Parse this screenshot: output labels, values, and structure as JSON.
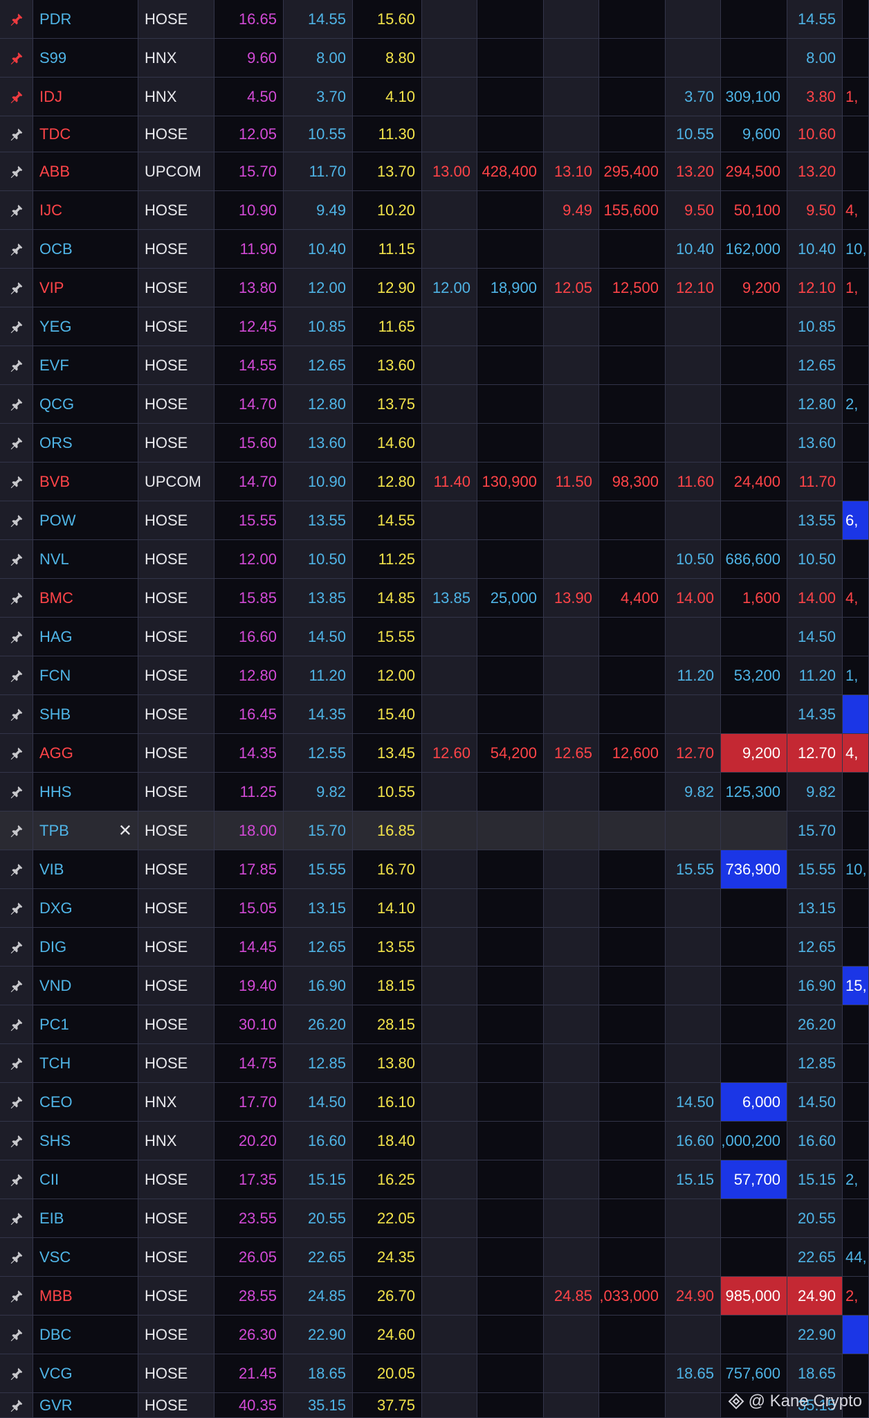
{
  "colors": {
    "ceiling": "#d24ad6",
    "floor": "#4fb4e6",
    "reference": "#f2e34a",
    "down": "#ff4448",
    "neutral": "#e8e8ec",
    "pin_active": "#ee3b40",
    "pin_default": "#c8c8cc",
    "bg_dark": "#0b0b12",
    "bg_alt": "#1d1d28"
  },
  "watermark": {
    "text": "@ Kane Crypto",
    "icon": "binance-diamond-icon"
  },
  "rows": [
    {
      "sym": "PDR",
      "sc": "floor",
      "ex": "HOSE",
      "ce": "16.65",
      "fl": "14.55",
      "rf": "15.60",
      "pin": "active",
      "b": [
        [
          "",
          ""
        ],
        [
          "",
          ""
        ],
        [
          "",
          ""
        ]
      ],
      "bc": [
        "",
        ""
      ],
      "m": [
        "14.55",
        "floor"
      ],
      "x": [
        "",
        ""
      ],
      "hl": ""
    },
    {
      "sym": "S99",
      "sc": "floor",
      "ex": "HNX",
      "ce": "9.60",
      "fl": "8.00",
      "rf": "8.80",
      "pin": "active",
      "b": [
        [
          "",
          ""
        ],
        [
          "",
          ""
        ],
        [
          "",
          ""
        ]
      ],
      "bc": [
        "",
        ""
      ],
      "m": [
        "8.00",
        "floor"
      ],
      "x": [
        "",
        ""
      ],
      "hl": ""
    },
    {
      "sym": "IDJ",
      "sc": "down",
      "ex": "HNX",
      "ce": "4.50",
      "fl": "3.70",
      "rf": "4.10",
      "pin": "active",
      "b": [
        [
          "",
          ""
        ],
        [
          "",
          ""
        ],
        [
          "3.70",
          "309,100"
        ]
      ],
      "bc": [
        "floor",
        "floor"
      ],
      "m": [
        "3.80",
        "down"
      ],
      "x": [
        "1,",
        "down"
      ],
      "hl": ""
    },
    {
      "sym": "TDC",
      "sc": "down",
      "ex": "HOSE",
      "ce": "12.05",
      "fl": "10.55",
      "rf": "11.30",
      "pin": "default",
      "b": [
        [
          "",
          ""
        ],
        [
          "",
          ""
        ],
        [
          "10.55",
          "9,600"
        ]
      ],
      "bc": [
        "floor",
        "floor"
      ],
      "m": [
        "10.60",
        "down"
      ],
      "x": [
        "",
        ""
      ],
      "hl": ""
    },
    {
      "sym": "ABB",
      "sc": "down",
      "ex": "UPCOM",
      "ce": "15.70",
      "fl": "11.70",
      "rf": "13.70",
      "pin": "default",
      "b": [
        [
          "13.00",
          "428,400"
        ],
        [
          "13.10",
          "295,400"
        ],
        [
          "13.20",
          "294,500"
        ]
      ],
      "bc": [
        "down",
        "down"
      ],
      "m": [
        "13.20",
        "down"
      ],
      "x": [
        "",
        ""
      ],
      "hl": ""
    },
    {
      "sym": "IJC",
      "sc": "down",
      "ex": "HOSE",
      "ce": "10.90",
      "fl": "9.49",
      "rf": "10.20",
      "pin": "default",
      "b": [
        [
          "",
          ""
        ],
        [
          "9.49",
          "155,600"
        ],
        [
          "9.50",
          "50,100"
        ]
      ],
      "bc": [
        "floor",
        "down"
      ],
      "m": [
        "9.50",
        "down"
      ],
      "x": [
        "4,",
        "down"
      ],
      "hl": ""
    },
    {
      "sym": "OCB",
      "sc": "floor",
      "ex": "HOSE",
      "ce": "11.90",
      "fl": "10.40",
      "rf": "11.15",
      "pin": "default",
      "b": [
        [
          "",
          ""
        ],
        [
          "",
          ""
        ],
        [
          "10.40",
          "162,000"
        ]
      ],
      "bc": [
        "floor",
        "floor"
      ],
      "m": [
        "10.40",
        "floor"
      ],
      "x": [
        "10,",
        "floor"
      ],
      "hl": ""
    },
    {
      "sym": "VIP",
      "sc": "down",
      "ex": "HOSE",
      "ce": "13.80",
      "fl": "12.00",
      "rf": "12.90",
      "pin": "default",
      "b": [
        [
          "12.00",
          "18,900"
        ],
        [
          "12.05",
          "12,500"
        ],
        [
          "12.10",
          "9,200"
        ]
      ],
      "bc": [
        "floor",
        "down"
      ],
      "m": [
        "12.10",
        "down"
      ],
      "x": [
        "1,",
        "down"
      ],
      "hl": ""
    },
    {
      "sym": "YEG",
      "sc": "floor",
      "ex": "HOSE",
      "ce": "12.45",
      "fl": "10.85",
      "rf": "11.65",
      "pin": "default",
      "b": [
        [
          "",
          ""
        ],
        [
          "",
          ""
        ],
        [
          "",
          ""
        ]
      ],
      "bc": [
        "",
        ""
      ],
      "m": [
        "10.85",
        "floor"
      ],
      "x": [
        "",
        ""
      ],
      "hl": ""
    },
    {
      "sym": "EVF",
      "sc": "floor",
      "ex": "HOSE",
      "ce": "14.55",
      "fl": "12.65",
      "rf": "13.60",
      "pin": "default",
      "b": [
        [
          "",
          ""
        ],
        [
          "",
          ""
        ],
        [
          "",
          ""
        ]
      ],
      "bc": [
        "",
        ""
      ],
      "m": [
        "12.65",
        "floor"
      ],
      "x": [
        "",
        ""
      ],
      "hl": ""
    },
    {
      "sym": "QCG",
      "sc": "floor",
      "ex": "HOSE",
      "ce": "14.70",
      "fl": "12.80",
      "rf": "13.75",
      "pin": "default",
      "b": [
        [
          "",
          ""
        ],
        [
          "",
          ""
        ],
        [
          "",
          ""
        ]
      ],
      "bc": [
        "",
        ""
      ],
      "m": [
        "12.80",
        "floor"
      ],
      "x": [
        "2,",
        "floor"
      ],
      "hl": ""
    },
    {
      "sym": "ORS",
      "sc": "floor",
      "ex": "HOSE",
      "ce": "15.60",
      "fl": "13.60",
      "rf": "14.60",
      "pin": "default",
      "b": [
        [
          "",
          ""
        ],
        [
          "",
          ""
        ],
        [
          "",
          ""
        ]
      ],
      "bc": [
        "",
        ""
      ],
      "m": [
        "13.60",
        "floor"
      ],
      "x": [
        "",
        ""
      ],
      "hl": ""
    },
    {
      "sym": "BVB",
      "sc": "down",
      "ex": "UPCOM",
      "ce": "14.70",
      "fl": "10.90",
      "rf": "12.80",
      "pin": "default",
      "b": [
        [
          "11.40",
          "130,900"
        ],
        [
          "11.50",
          "98,300"
        ],
        [
          "11.60",
          "24,400"
        ]
      ],
      "bc": [
        "down",
        "down"
      ],
      "m": [
        "11.70",
        "down"
      ],
      "x": [
        "",
        ""
      ],
      "hl": ""
    },
    {
      "sym": "POW",
      "sc": "floor",
      "ex": "HOSE",
      "ce": "15.55",
      "fl": "13.55",
      "rf": "14.55",
      "pin": "default",
      "b": [
        [
          "",
          ""
        ],
        [
          "",
          ""
        ],
        [
          "",
          ""
        ]
      ],
      "bc": [
        "",
        ""
      ],
      "m": [
        "13.55",
        "floor"
      ],
      "x": [
        "6,",
        "floor"
      ],
      "hl": "x-blue"
    },
    {
      "sym": "NVL",
      "sc": "floor",
      "ex": "HOSE",
      "ce": "12.00",
      "fl": "10.50",
      "rf": "11.25",
      "pin": "default",
      "b": [
        [
          "",
          ""
        ],
        [
          "",
          ""
        ],
        [
          "10.50",
          "686,600"
        ]
      ],
      "bc": [
        "floor",
        "floor"
      ],
      "m": [
        "10.50",
        "floor"
      ],
      "x": [
        "",
        ""
      ],
      "hl": ""
    },
    {
      "sym": "BMC",
      "sc": "down",
      "ex": "HOSE",
      "ce": "15.85",
      "fl": "13.85",
      "rf": "14.85",
      "pin": "default",
      "b": [
        [
          "13.85",
          "25,000"
        ],
        [
          "13.90",
          "4,400"
        ],
        [
          "14.00",
          "1,600"
        ]
      ],
      "bc": [
        "floor",
        "down"
      ],
      "m": [
        "14.00",
        "down"
      ],
      "x": [
        "4,",
        "down"
      ],
      "hl": ""
    },
    {
      "sym": "HAG",
      "sc": "floor",
      "ex": "HOSE",
      "ce": "16.60",
      "fl": "14.50",
      "rf": "15.55",
      "pin": "default",
      "b": [
        [
          "",
          ""
        ],
        [
          "",
          ""
        ],
        [
          "",
          ""
        ]
      ],
      "bc": [
        "",
        ""
      ],
      "m": [
        "14.50",
        "floor"
      ],
      "x": [
        "",
        ""
      ],
      "hl": ""
    },
    {
      "sym": "FCN",
      "sc": "floor",
      "ex": "HOSE",
      "ce": "12.80",
      "fl": "11.20",
      "rf": "12.00",
      "pin": "default",
      "b": [
        [
          "",
          ""
        ],
        [
          "",
          ""
        ],
        [
          "11.20",
          "53,200"
        ]
      ],
      "bc": [
        "floor",
        "floor"
      ],
      "m": [
        "11.20",
        "floor"
      ],
      "x": [
        "1,",
        "floor"
      ],
      "hl": ""
    },
    {
      "sym": "SHB",
      "sc": "floor",
      "ex": "HOSE",
      "ce": "16.45",
      "fl": "14.35",
      "rf": "15.40",
      "pin": "default",
      "b": [
        [
          "",
          ""
        ],
        [
          "",
          ""
        ],
        [
          "",
          ""
        ]
      ],
      "bc": [
        "",
        ""
      ],
      "m": [
        "14.35",
        "floor"
      ],
      "x": [
        "",
        ""
      ],
      "hl": "x-blue"
    },
    {
      "sym": "AGG",
      "sc": "down",
      "ex": "HOSE",
      "ce": "14.35",
      "fl": "12.55",
      "rf": "13.45",
      "pin": "default",
      "b": [
        [
          "12.60",
          "54,200"
        ],
        [
          "12.65",
          "12,600"
        ],
        [
          "12.70",
          "9,200"
        ]
      ],
      "bc": [
        "down",
        "down"
      ],
      "m": [
        "12.70",
        "down"
      ],
      "x": [
        "4,",
        "down"
      ],
      "hl": "v3-red m-red x-red"
    },
    {
      "sym": "HHS",
      "sc": "floor",
      "ex": "HOSE",
      "ce": "11.25",
      "fl": "9.82",
      "rf": "10.55",
      "pin": "default",
      "b": [
        [
          "",
          ""
        ],
        [
          "",
          ""
        ],
        [
          "9.82",
          "125,300"
        ]
      ],
      "bc": [
        "floor",
        "floor"
      ],
      "m": [
        "9.82",
        "floor"
      ],
      "x": [
        "",
        ""
      ],
      "hl": ""
    },
    {
      "sym": "TPB",
      "sc": "floor",
      "ex": "HOSE",
      "ce": "18.00",
      "fl": "15.70",
      "rf": "16.85",
      "pin": "default",
      "b": [
        [
          "",
          ""
        ],
        [
          "",
          ""
        ],
        [
          "",
          ""
        ]
      ],
      "bc": [
        "",
        ""
      ],
      "m": [
        "15.70",
        "floor"
      ],
      "x": [
        "",
        ""
      ],
      "hl": "",
      "selected": true
    },
    {
      "sym": "VIB",
      "sc": "floor",
      "ex": "HOSE",
      "ce": "17.85",
      "fl": "15.55",
      "rf": "16.70",
      "pin": "default",
      "b": [
        [
          "",
          ""
        ],
        [
          "",
          ""
        ],
        [
          "15.55",
          "736,900"
        ]
      ],
      "bc": [
        "floor",
        "floor"
      ],
      "m": [
        "15.55",
        "floor"
      ],
      "x": [
        "10,",
        "floor"
      ],
      "hl": "v3-blue"
    },
    {
      "sym": "DXG",
      "sc": "floor",
      "ex": "HOSE",
      "ce": "15.05",
      "fl": "13.15",
      "rf": "14.10",
      "pin": "default",
      "b": [
        [
          "",
          ""
        ],
        [
          "",
          ""
        ],
        [
          "",
          ""
        ]
      ],
      "bc": [
        "",
        ""
      ],
      "m": [
        "13.15",
        "floor"
      ],
      "x": [
        "",
        ""
      ],
      "hl": ""
    },
    {
      "sym": "DIG",
      "sc": "floor",
      "ex": "HOSE",
      "ce": "14.45",
      "fl": "12.65",
      "rf": "13.55",
      "pin": "default",
      "b": [
        [
          "",
          ""
        ],
        [
          "",
          ""
        ],
        [
          "",
          ""
        ]
      ],
      "bc": [
        "",
        ""
      ],
      "m": [
        "12.65",
        "floor"
      ],
      "x": [
        "",
        ""
      ],
      "hl": ""
    },
    {
      "sym": "VND",
      "sc": "floor",
      "ex": "HOSE",
      "ce": "19.40",
      "fl": "16.90",
      "rf": "18.15",
      "pin": "default",
      "b": [
        [
          "",
          ""
        ],
        [
          "",
          ""
        ],
        [
          "",
          ""
        ]
      ],
      "bc": [
        "",
        ""
      ],
      "m": [
        "16.90",
        "floor"
      ],
      "x": [
        "15,",
        "floor"
      ],
      "hl": "x-blue"
    },
    {
      "sym": "PC1",
      "sc": "floor",
      "ex": "HOSE",
      "ce": "30.10",
      "fl": "26.20",
      "rf": "28.15",
      "pin": "default",
      "b": [
        [
          "",
          ""
        ],
        [
          "",
          ""
        ],
        [
          "",
          ""
        ]
      ],
      "bc": [
        "",
        ""
      ],
      "m": [
        "26.20",
        "floor"
      ],
      "x": [
        "",
        ""
      ],
      "hl": ""
    },
    {
      "sym": "TCH",
      "sc": "floor",
      "ex": "HOSE",
      "ce": "14.75",
      "fl": "12.85",
      "rf": "13.80",
      "pin": "default",
      "b": [
        [
          "",
          ""
        ],
        [
          "",
          ""
        ],
        [
          "",
          ""
        ]
      ],
      "bc": [
        "",
        ""
      ],
      "m": [
        "12.85",
        "floor"
      ],
      "x": [
        "",
        ""
      ],
      "hl": ""
    },
    {
      "sym": "CEO",
      "sc": "floor",
      "ex": "HNX",
      "ce": "17.70",
      "fl": "14.50",
      "rf": "16.10",
      "pin": "default",
      "b": [
        [
          "",
          ""
        ],
        [
          "",
          ""
        ],
        [
          "14.50",
          "6,000"
        ]
      ],
      "bc": [
        "floor",
        "floor"
      ],
      "m": [
        "14.50",
        "floor"
      ],
      "x": [
        "",
        ""
      ],
      "hl": "v3-blue"
    },
    {
      "sym": "SHS",
      "sc": "floor",
      "ex": "HNX",
      "ce": "20.20",
      "fl": "16.60",
      "rf": "18.40",
      "pin": "default",
      "b": [
        [
          "",
          ""
        ],
        [
          "",
          ""
        ],
        [
          "16.60",
          ",000,200"
        ]
      ],
      "bc": [
        "floor",
        "floor"
      ],
      "m": [
        "16.60",
        "floor"
      ],
      "x": [
        "",
        ""
      ],
      "hl": ""
    },
    {
      "sym": "CII",
      "sc": "floor",
      "ex": "HOSE",
      "ce": "17.35",
      "fl": "15.15",
      "rf": "16.25",
      "pin": "default",
      "b": [
        [
          "",
          ""
        ],
        [
          "",
          ""
        ],
        [
          "15.15",
          "57,700"
        ]
      ],
      "bc": [
        "floor",
        "floor"
      ],
      "m": [
        "15.15",
        "floor"
      ],
      "x": [
        "2,",
        "floor"
      ],
      "hl": "v3-blue"
    },
    {
      "sym": "EIB",
      "sc": "floor",
      "ex": "HOSE",
      "ce": "23.55",
      "fl": "20.55",
      "rf": "22.05",
      "pin": "default",
      "b": [
        [
          "",
          ""
        ],
        [
          "",
          ""
        ],
        [
          "",
          ""
        ]
      ],
      "bc": [
        "",
        ""
      ],
      "m": [
        "20.55",
        "floor"
      ],
      "x": [
        "",
        ""
      ],
      "hl": ""
    },
    {
      "sym": "VSC",
      "sc": "floor",
      "ex": "HOSE",
      "ce": "26.05",
      "fl": "22.65",
      "rf": "24.35",
      "pin": "default",
      "b": [
        [
          "",
          ""
        ],
        [
          "",
          ""
        ],
        [
          "",
          ""
        ]
      ],
      "bc": [
        "",
        ""
      ],
      "m": [
        "22.65",
        "floor"
      ],
      "x": [
        "44,",
        "floor"
      ],
      "hl": ""
    },
    {
      "sym": "MBB",
      "sc": "down",
      "ex": "HOSE",
      "ce": "28.55",
      "fl": "24.85",
      "rf": "26.70",
      "pin": "default",
      "b": [
        [
          "",
          ""
        ],
        [
          "24.85",
          ",033,000"
        ],
        [
          "24.90",
          "985,000"
        ]
      ],
      "bc": [
        "floor",
        "down"
      ],
      "m": [
        "24.90",
        "down"
      ],
      "x": [
        "2,",
        "down"
      ],
      "hl": "v3-red m-red"
    },
    {
      "sym": "DBC",
      "sc": "floor",
      "ex": "HOSE",
      "ce": "26.30",
      "fl": "22.90",
      "rf": "24.60",
      "pin": "default",
      "b": [
        [
          "",
          ""
        ],
        [
          "",
          ""
        ],
        [
          "",
          ""
        ]
      ],
      "bc": [
        "",
        ""
      ],
      "m": [
        "22.90",
        "floor"
      ],
      "x": [
        "",
        ""
      ],
      "hl": "x-blue"
    },
    {
      "sym": "VCG",
      "sc": "floor",
      "ex": "HOSE",
      "ce": "21.45",
      "fl": "18.65",
      "rf": "20.05",
      "pin": "default",
      "b": [
        [
          "",
          ""
        ],
        [
          "",
          ""
        ],
        [
          "18.65",
          "757,600"
        ]
      ],
      "bc": [
        "floor",
        "floor"
      ],
      "m": [
        "18.65",
        "floor"
      ],
      "x": [
        "",
        ""
      ],
      "hl": ""
    },
    {
      "sym": "GVR",
      "sc": "floor",
      "ex": "HOSE",
      "ce": "40.35",
      "fl": "35.15",
      "rf": "37.75",
      "pin": "default",
      "b": [
        [
          "",
          ""
        ],
        [
          "",
          ""
        ],
        [
          "",
          ""
        ]
      ],
      "bc": [
        "",
        ""
      ],
      "m": [
        "35.15",
        "floor"
      ],
      "x": [
        "",
        ""
      ],
      "hl": ""
    }
  ]
}
